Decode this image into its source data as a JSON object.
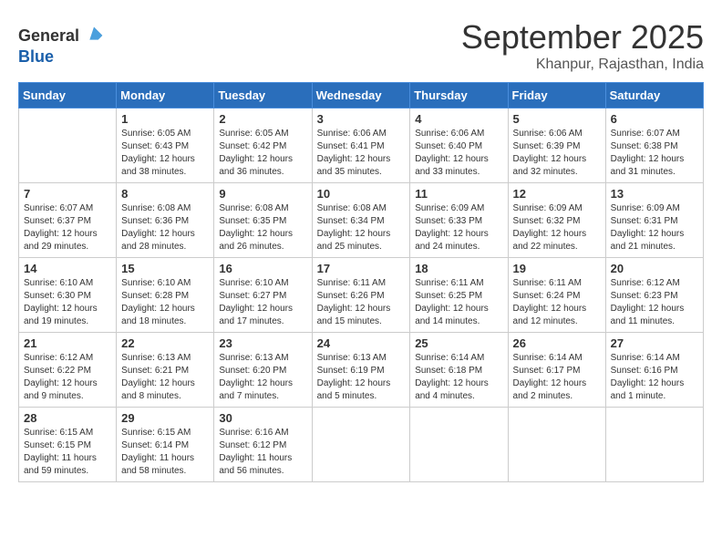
{
  "header": {
    "logo_general": "General",
    "logo_blue": "Blue",
    "month_title": "September 2025",
    "subtitle": "Khanpur, Rajasthan, India"
  },
  "weekdays": [
    "Sunday",
    "Monday",
    "Tuesday",
    "Wednesday",
    "Thursday",
    "Friday",
    "Saturday"
  ],
  "weeks": [
    [
      {
        "day": "",
        "info": ""
      },
      {
        "day": "1",
        "info": "Sunrise: 6:05 AM\nSunset: 6:43 PM\nDaylight: 12 hours\nand 38 minutes."
      },
      {
        "day": "2",
        "info": "Sunrise: 6:05 AM\nSunset: 6:42 PM\nDaylight: 12 hours\nand 36 minutes."
      },
      {
        "day": "3",
        "info": "Sunrise: 6:06 AM\nSunset: 6:41 PM\nDaylight: 12 hours\nand 35 minutes."
      },
      {
        "day": "4",
        "info": "Sunrise: 6:06 AM\nSunset: 6:40 PM\nDaylight: 12 hours\nand 33 minutes."
      },
      {
        "day": "5",
        "info": "Sunrise: 6:06 AM\nSunset: 6:39 PM\nDaylight: 12 hours\nand 32 minutes."
      },
      {
        "day": "6",
        "info": "Sunrise: 6:07 AM\nSunset: 6:38 PM\nDaylight: 12 hours\nand 31 minutes."
      }
    ],
    [
      {
        "day": "7",
        "info": "Sunrise: 6:07 AM\nSunset: 6:37 PM\nDaylight: 12 hours\nand 29 minutes."
      },
      {
        "day": "8",
        "info": "Sunrise: 6:08 AM\nSunset: 6:36 PM\nDaylight: 12 hours\nand 28 minutes."
      },
      {
        "day": "9",
        "info": "Sunrise: 6:08 AM\nSunset: 6:35 PM\nDaylight: 12 hours\nand 26 minutes."
      },
      {
        "day": "10",
        "info": "Sunrise: 6:08 AM\nSunset: 6:34 PM\nDaylight: 12 hours\nand 25 minutes."
      },
      {
        "day": "11",
        "info": "Sunrise: 6:09 AM\nSunset: 6:33 PM\nDaylight: 12 hours\nand 24 minutes."
      },
      {
        "day": "12",
        "info": "Sunrise: 6:09 AM\nSunset: 6:32 PM\nDaylight: 12 hours\nand 22 minutes."
      },
      {
        "day": "13",
        "info": "Sunrise: 6:09 AM\nSunset: 6:31 PM\nDaylight: 12 hours\nand 21 minutes."
      }
    ],
    [
      {
        "day": "14",
        "info": "Sunrise: 6:10 AM\nSunset: 6:30 PM\nDaylight: 12 hours\nand 19 minutes."
      },
      {
        "day": "15",
        "info": "Sunrise: 6:10 AM\nSunset: 6:28 PM\nDaylight: 12 hours\nand 18 minutes."
      },
      {
        "day": "16",
        "info": "Sunrise: 6:10 AM\nSunset: 6:27 PM\nDaylight: 12 hours\nand 17 minutes."
      },
      {
        "day": "17",
        "info": "Sunrise: 6:11 AM\nSunset: 6:26 PM\nDaylight: 12 hours\nand 15 minutes."
      },
      {
        "day": "18",
        "info": "Sunrise: 6:11 AM\nSunset: 6:25 PM\nDaylight: 12 hours\nand 14 minutes."
      },
      {
        "day": "19",
        "info": "Sunrise: 6:11 AM\nSunset: 6:24 PM\nDaylight: 12 hours\nand 12 minutes."
      },
      {
        "day": "20",
        "info": "Sunrise: 6:12 AM\nSunset: 6:23 PM\nDaylight: 12 hours\nand 11 minutes."
      }
    ],
    [
      {
        "day": "21",
        "info": "Sunrise: 6:12 AM\nSunset: 6:22 PM\nDaylight: 12 hours\nand 9 minutes."
      },
      {
        "day": "22",
        "info": "Sunrise: 6:13 AM\nSunset: 6:21 PM\nDaylight: 12 hours\nand 8 minutes."
      },
      {
        "day": "23",
        "info": "Sunrise: 6:13 AM\nSunset: 6:20 PM\nDaylight: 12 hours\nand 7 minutes."
      },
      {
        "day": "24",
        "info": "Sunrise: 6:13 AM\nSunset: 6:19 PM\nDaylight: 12 hours\nand 5 minutes."
      },
      {
        "day": "25",
        "info": "Sunrise: 6:14 AM\nSunset: 6:18 PM\nDaylight: 12 hours\nand 4 minutes."
      },
      {
        "day": "26",
        "info": "Sunrise: 6:14 AM\nSunset: 6:17 PM\nDaylight: 12 hours\nand 2 minutes."
      },
      {
        "day": "27",
        "info": "Sunrise: 6:14 AM\nSunset: 6:16 PM\nDaylight: 12 hours\nand 1 minute."
      }
    ],
    [
      {
        "day": "28",
        "info": "Sunrise: 6:15 AM\nSunset: 6:15 PM\nDaylight: 11 hours\nand 59 minutes."
      },
      {
        "day": "29",
        "info": "Sunrise: 6:15 AM\nSunset: 6:14 PM\nDaylight: 11 hours\nand 58 minutes."
      },
      {
        "day": "30",
        "info": "Sunrise: 6:16 AM\nSunset: 6:12 PM\nDaylight: 11 hours\nand 56 minutes."
      },
      {
        "day": "",
        "info": ""
      },
      {
        "day": "",
        "info": ""
      },
      {
        "day": "",
        "info": ""
      },
      {
        "day": "",
        "info": ""
      }
    ]
  ]
}
